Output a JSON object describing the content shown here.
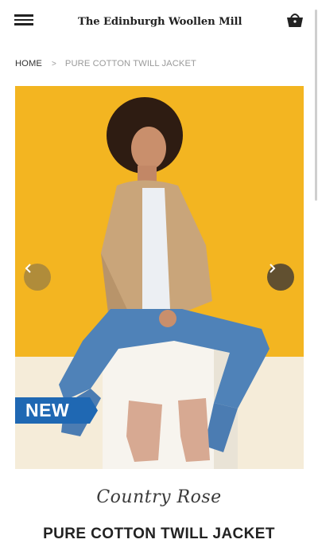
{
  "header": {
    "logo_text": "The Edinburgh Woollen Mill",
    "menu_icon": "hamburger-menu-icon",
    "basket_icon": "shopping-basket-icon"
  },
  "breadcrumb": {
    "home": "HOME",
    "separator": ">",
    "current": "PURE COTTON TWILL JACKET"
  },
  "gallery": {
    "badge": "NEW",
    "prev_icon": "chevron-left-icon",
    "next_icon": "chevron-right-icon",
    "badge_color": "#1f68b3",
    "background_color": "#f3b521"
  },
  "product": {
    "brand": "Country Rose",
    "title": "PURE COTTON TWILL JACKET"
  }
}
